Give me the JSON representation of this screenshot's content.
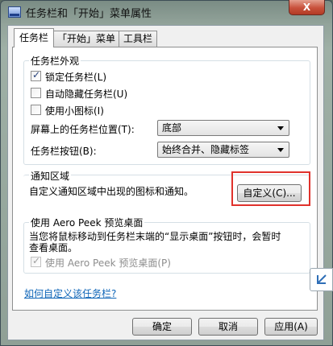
{
  "window": {
    "title": "任务栏和「开始」菜单属性",
    "close_label": "X"
  },
  "tabs": [
    {
      "label": "任务栏",
      "active": true
    },
    {
      "label": "「开始」菜单",
      "active": false
    },
    {
      "label": "工具栏",
      "active": false
    }
  ],
  "appearance": {
    "group_label": "任务栏外观",
    "lock_taskbar": {
      "label": "锁定任务栏(L)",
      "checked": true
    },
    "auto_hide": {
      "label": "自动隐藏任务栏(U)",
      "checked": false
    },
    "small_icons": {
      "label": "使用小图标(I)",
      "checked": false
    },
    "location_label": "屏幕上的任务栏位置(T):",
    "location_value": "底部",
    "buttons_label": "任务栏按钮(B):",
    "buttons_value": "始终合并、隐藏标签"
  },
  "notification": {
    "group_label": "通知区域",
    "description": "自定义通知区域中出现的图标和通知。",
    "customize_button": "自定义(C)..."
  },
  "aero_peek": {
    "group_label": "使用 Aero Peek 预览桌面",
    "description_line1": "当您将鼠标移动到任务栏末端的“显示桌面”按钮时，会暂时",
    "description_line2": "查看桌面。",
    "checkbox_label": "使用 Aero Peek 预览桌面(P)",
    "checked": true,
    "disabled": true
  },
  "help_link": "如何自定义该任务栏?",
  "footer": {
    "ok": "确定",
    "cancel": "取消",
    "apply": "应用(A)"
  },
  "colors": {
    "highlight": "#e0322c",
    "link": "#1066b8"
  }
}
